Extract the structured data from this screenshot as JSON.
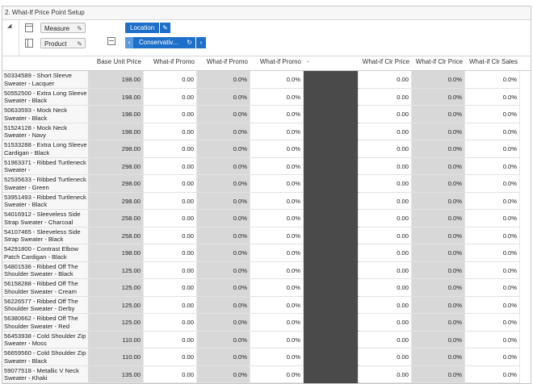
{
  "title": "2. What-If Price Point Setup",
  "toolbar": {
    "measure_label": "Measure",
    "product_label": "Product",
    "location_label": "Location",
    "filter_label": "Conservativ..."
  },
  "columns": [
    "Base Unit Price",
    "What-if Promo",
    "What-if Promo",
    "What-if Promo",
    "-",
    "What-if Clr Price",
    "What-if Clr Price",
    "What-if Clr Sales"
  ],
  "rows": [
    {
      "label": "50334589 - Short Sleeve Sweater - Lacquer",
      "values": [
        "198.00",
        "0.00",
        "0.0%",
        "0.0%",
        "",
        "0.00",
        "0.0%",
        "0.0%"
      ]
    },
    {
      "label": "50552500 - Extra Long Sleeve Sweater - Black",
      "values": [
        "198.00",
        "0.00",
        "0.0%",
        "0.0%",
        "",
        "0.00",
        "0.0%",
        "0.0%"
      ]
    },
    {
      "label": "50633593 - Mock Neck Sweater - Black",
      "values": [
        "198.00",
        "0.00",
        "0.0%",
        "0.0%",
        "",
        "0.00",
        "0.0%",
        "0.0%"
      ]
    },
    {
      "label": "51524128 - Mock Neck Sweater - Navy",
      "values": [
        "198.00",
        "0.00",
        "0.0%",
        "0.0%",
        "",
        "0.00",
        "0.0%",
        "0.0%"
      ]
    },
    {
      "label": "51533288 - Extra Long Sleeve Cardigan - Black",
      "values": [
        "298.00",
        "0.00",
        "0.0%",
        "0.0%",
        "",
        "0.00",
        "0.0%",
        "0.0%"
      ]
    },
    {
      "label": "51963371 - Ribbed Turtleneck Sweater -",
      "values": [
        "298.00",
        "0.00",
        "0.0%",
        "0.0%",
        "",
        "0.00",
        "0.0%",
        "0.0%"
      ]
    },
    {
      "label": "52535633 - Ribbed Turtleneck Sweater - Green",
      "values": [
        "298.00",
        "0.00",
        "0.0%",
        "0.0%",
        "",
        "0.00",
        "0.0%",
        "0.0%"
      ]
    },
    {
      "label": "53951493 - Ribbed Turtleneck Sweater - Black",
      "values": [
        "298.00",
        "0.00",
        "0.0%",
        "0.0%",
        "",
        "0.00",
        "0.0%",
        "0.0%"
      ]
    },
    {
      "label": "54016912 - Sleeveless Side Strap Sweater - Charcoal",
      "values": [
        "258.00",
        "0.00",
        "0.0%",
        "0.0%",
        "",
        "0.00",
        "0.0%",
        "0.0%"
      ]
    },
    {
      "label": "54107465 - Sleeveless Side Strap Sweater - Black",
      "values": [
        "258.00",
        "0.00",
        "0.0%",
        "0.0%",
        "",
        "0.00",
        "0.0%",
        "0.0%"
      ]
    },
    {
      "label": "54291800 - Contrast Elbow Patch Cardigan - Black",
      "values": [
        "198.00",
        "0.00",
        "0.0%",
        "0.0%",
        "",
        "0.00",
        "0.0%",
        "0.0%"
      ]
    },
    {
      "label": "54801536 - Ribbed Off The Shoulder Sweater - Black",
      "values": [
        "125.00",
        "0.00",
        "0.0%",
        "0.0%",
        "",
        "0.00",
        "0.0%",
        "0.0%"
      ]
    },
    {
      "label": "56158288 - Ribbed Off The Shoulder Sweater - Cream",
      "values": [
        "125.00",
        "0.00",
        "0.0%",
        "0.0%",
        "",
        "0.00",
        "0.0%",
        "0.0%"
      ]
    },
    {
      "label": "56226577 - Ribbed Off The Shoulder Sweater - Derby",
      "values": [
        "125.00",
        "0.00",
        "0.0%",
        "0.0%",
        "",
        "0.00",
        "0.0%",
        "0.0%"
      ]
    },
    {
      "label": "56380662 - Ribbed Off The Shoulder Sweater - Red",
      "values": [
        "125.00",
        "0.00",
        "0.0%",
        "0.0%",
        "",
        "0.00",
        "0.0%",
        "0.0%"
      ]
    },
    {
      "label": "56453938 - Cold Shoulder Zip Sweater - Moss",
      "values": [
        "110.00",
        "0.00",
        "0.0%",
        "0.0%",
        "",
        "0.00",
        "0.0%",
        "0.0%"
      ]
    },
    {
      "label": "56659560 - Cold Shoulder Zip Sweater - Black",
      "values": [
        "110.00",
        "0.00",
        "0.0%",
        "0.0%",
        "",
        "0.00",
        "0.0%",
        "0.0%"
      ]
    },
    {
      "label": "59077518 - Metallic V Neck Sweater - Khaki",
      "values": [
        "135.00",
        "0.00",
        "0.0%",
        "0.0%",
        "",
        "0.00",
        "0.0%",
        "0.0%"
      ]
    }
  ],
  "colors": {
    "accent": "#1e6fc9",
    "gray_cell": "#d8d8d8",
    "dark_cell": "#4a4a4a"
  }
}
